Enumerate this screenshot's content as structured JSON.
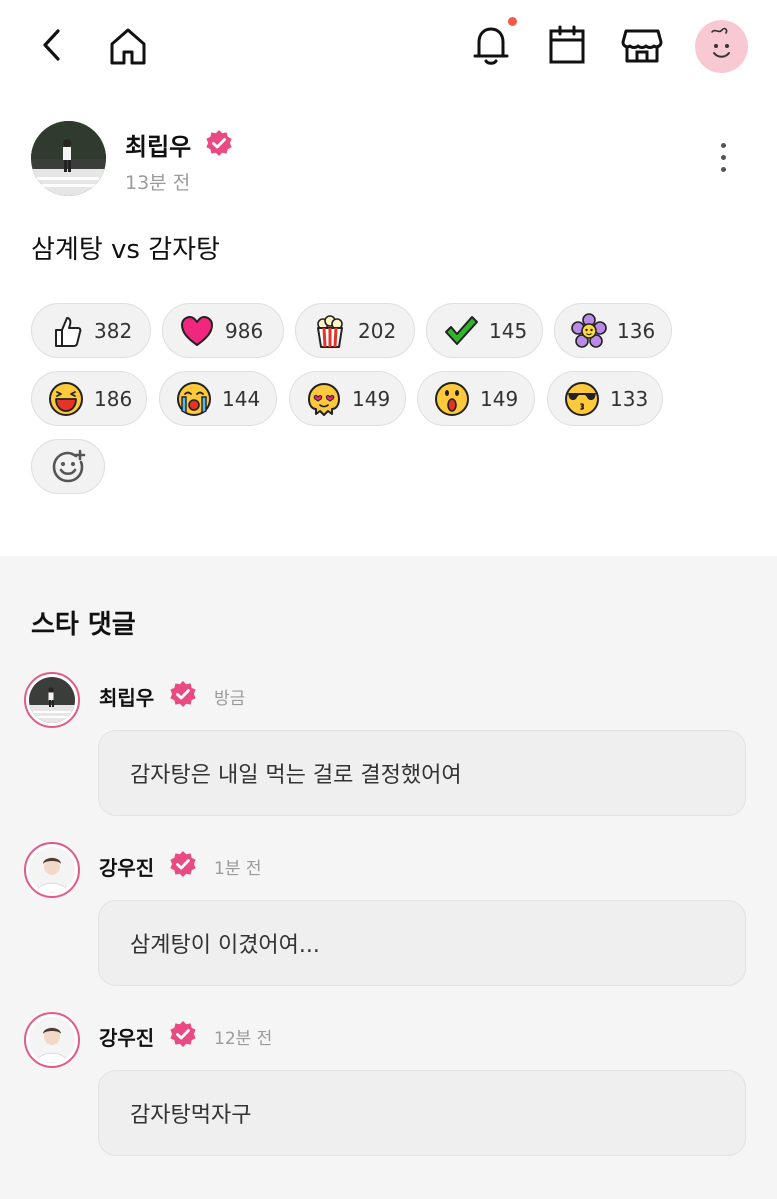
{
  "nav": {
    "icons": [
      "back-icon",
      "home-icon",
      "bell-icon",
      "calendar-icon",
      "store-icon",
      "profile-avatar"
    ],
    "has_notification": true,
    "colors": {
      "notification_dot": "#f05a4a",
      "profile_bg": "#f9c9d3"
    }
  },
  "post": {
    "author": "최립우",
    "time": "13분 전",
    "body": "삼계탕 vs 감자탕"
  },
  "reactions": [
    {
      "icon": "thumbs-up-icon",
      "count": "382"
    },
    {
      "icon": "heart-icon",
      "count": "986"
    },
    {
      "icon": "popcorn-icon",
      "count": "202"
    },
    {
      "icon": "check-icon",
      "count": "145"
    },
    {
      "icon": "flower-icon",
      "count": "136"
    },
    {
      "icon": "laughing-face-icon",
      "count": "186"
    },
    {
      "icon": "crying-face-icon",
      "count": "144"
    },
    {
      "icon": "melting-love-face-icon",
      "count": "149"
    },
    {
      "icon": "surprised-face-icon",
      "count": "149"
    },
    {
      "icon": "sunglasses-kiss-face-icon",
      "count": "133"
    }
  ],
  "comments": {
    "title": "스타 댓글",
    "items": [
      {
        "name": "최립우",
        "time": "방금",
        "text": "감자탕은 내일 먹는 걸로 결정했어여"
      },
      {
        "name": "강우진",
        "time": "1분 전",
        "text": "삼계탕이 이겼어여..."
      },
      {
        "name": "강우진",
        "time": "12분 전",
        "text": "감자탕먹자구"
      }
    ]
  },
  "colors": {
    "verified": "#ea4a82",
    "accent_ring": "#e05b86",
    "section_bg": "#f5f5f5"
  }
}
